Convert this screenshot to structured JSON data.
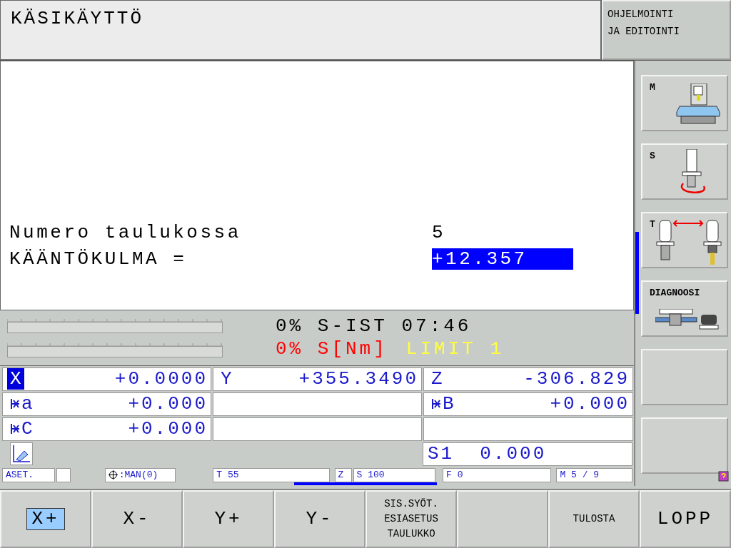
{
  "header": {
    "title": "KÄSIKÄYTTÖ",
    "mode_button": [
      "OHJELMOINTI",
      "JA EDITOINTI"
    ]
  },
  "dialog": [
    {
      "label": "Numero taulukossa",
      "value": "5",
      "selected": false
    },
    {
      "label": "KÄÄNTÖKULMA =",
      "value": "+12.357",
      "selected": true
    }
  ],
  "load": [
    {
      "texts": [
        {
          "text": "0% S-IST 07:46",
          "color": "#000000"
        }
      ]
    },
    {
      "texts": [
        {
          "text": "0% S[Nm]",
          "color": "#ff0000"
        },
        {
          "text": "LIMIT 1",
          "color": "#ffff40"
        }
      ]
    }
  ],
  "positions": [
    [
      {
        "kind": "axis",
        "axis": "X",
        "value": "+0.0000",
        "clamped": false,
        "selected": true
      },
      {
        "kind": "axis",
        "axis": "Y",
        "value": "+355.3490",
        "clamped": false,
        "selected": false
      },
      {
        "kind": "axis",
        "axis": "Z",
        "value": "-306.829",
        "clamped": false,
        "selected": false
      }
    ],
    [
      {
        "kind": "axis",
        "axis": "a",
        "value": "+0.000",
        "clamped": true,
        "selected": false
      },
      {
        "kind": "empty"
      },
      {
        "kind": "axis",
        "axis": "B",
        "value": "+0.000",
        "clamped": true,
        "selected": false
      }
    ],
    [
      {
        "kind": "axis",
        "axis": "C",
        "value": "+0.000",
        "clamped": true,
        "selected": false
      },
      {
        "kind": "empty"
      },
      {
        "kind": "empty"
      }
    ]
  ],
  "spindle": {
    "axis": "S1",
    "value": "0.000"
  },
  "status": [
    {
      "text": "ASET.",
      "kind": "cell"
    },
    {
      "kind": "blank"
    },
    {
      "text": ":MAN(0)",
      "kind": "datum"
    },
    {
      "text": "T 55",
      "kind": "cell"
    },
    {
      "text": "Z",
      "kind": "cell"
    },
    {
      "text": "S 100",
      "kind": "cell"
    },
    {
      "text": "F 0",
      "kind": "cell"
    },
    {
      "text": "M 5 / 9",
      "kind": "cell"
    }
  ],
  "side_softkeys": [
    {
      "label": "M",
      "kind": "machine"
    },
    {
      "label": "S",
      "kind": "spindle"
    },
    {
      "label": "T",
      "kind": "tool"
    },
    {
      "label": "DIAGNOOSI",
      "kind": "diagnosis"
    },
    {
      "kind": "empty"
    },
    {
      "kind": "empty"
    }
  ],
  "softkeys": [
    {
      "label": "X+",
      "selected": true,
      "kind": "large"
    },
    {
      "label": "X-",
      "selected": false,
      "kind": "large"
    },
    {
      "label": "Y+",
      "selected": false,
      "kind": "large"
    },
    {
      "label": "Y-",
      "selected": false,
      "kind": "large"
    },
    {
      "lines": [
        "SIS.SYÖT.",
        "ESIASETUS",
        "TAULUKKO"
      ],
      "selected": false,
      "kind": "small"
    },
    {
      "kind": "empty"
    },
    {
      "label": "TULOSTA",
      "selected": false,
      "kind": "small"
    },
    {
      "label": "LOPP",
      "selected": false,
      "kind": "large"
    }
  ]
}
